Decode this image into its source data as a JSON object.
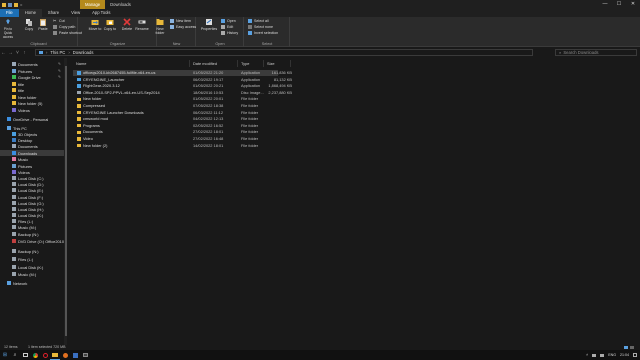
{
  "window": {
    "ribbon_context_tab": "Manage",
    "context_title": "Downloads",
    "minimize_glyph": "—",
    "maximize_glyph": "☐",
    "close_glyph": "✕",
    "title_glyph": "="
  },
  "ribbon_tabs": [
    "File",
    "Home",
    "Share",
    "View",
    "App Tools"
  ],
  "ribbon": {
    "clipboard": {
      "label": "Clipboard",
      "pin": "Pin to Quick access",
      "copy": "Copy",
      "paste": "Paste",
      "cut": "Cut",
      "copy_path": "Copy path",
      "paste_shortcut": "Paste shortcut"
    },
    "organize": {
      "label": "Organize",
      "move_to": "Move to",
      "copy_to": "Copy to",
      "delete": "Delete",
      "rename": "Rename"
    },
    "new": {
      "label": "New",
      "new_folder": "New folder",
      "new_item": "New item",
      "easy_access": "Easy access"
    },
    "open": {
      "label": "Open",
      "properties": "Properties",
      "open": "Open",
      "edit": "Edit",
      "history": "History"
    },
    "select": {
      "label": "Select",
      "select_all": "Select all",
      "select_none": "Select none",
      "invert_selection": "Invert selection"
    }
  },
  "address": {
    "back": "←",
    "forward": "→",
    "recent": "˅",
    "up": "↑",
    "crumbs": [
      "This PC",
      "Downloads"
    ],
    "search_placeholder": "Search Downloads"
  },
  "nav": {
    "items": [
      {
        "label": "Documents",
        "icon": "documents-icon",
        "pinned": true
      },
      {
        "label": "Pictures",
        "icon": "pictures-icon",
        "pinned": true
      },
      {
        "label": "Google Drive",
        "icon": "google-drive-icon",
        "pinned": true
      },
      {
        "label": "title",
        "icon": "folder-icon",
        "pinned": false
      },
      {
        "label": "title",
        "icon": "folder-icon",
        "pinned": false
      },
      {
        "label": "New folder",
        "icon": "folder-icon",
        "pinned": false
      },
      {
        "label": "New folder (5)",
        "icon": "folder-icon",
        "pinned": false
      },
      {
        "label": "Videos",
        "icon": "videos-icon",
        "pinned": false
      },
      {
        "label": "OneDrive - Personal",
        "icon": "onedrive-icon",
        "pinned": false
      },
      {
        "label": "This PC",
        "icon": "this-pc-icon",
        "pinned": false
      },
      {
        "label": "3D Objects",
        "icon": "3d-objects-icon",
        "pinned": false
      },
      {
        "label": "Desktop",
        "icon": "desktop-icon",
        "pinned": false
      },
      {
        "label": "Documents",
        "icon": "documents-icon",
        "pinned": false
      },
      {
        "label": "Downloads",
        "icon": "downloads-icon",
        "pinned": false
      },
      {
        "label": "Music",
        "icon": "music-icon",
        "pinned": false
      },
      {
        "label": "Pictures",
        "icon": "pictures-icon",
        "pinned": false
      },
      {
        "label": "Videos",
        "icon": "videos-icon",
        "pinned": false
      },
      {
        "label": "Local Disk (C:)",
        "icon": "drive-icon",
        "pinned": false
      },
      {
        "label": "Local Disk (D:)",
        "icon": "drive-icon",
        "pinned": false
      },
      {
        "label": "Local Disk (E:)",
        "icon": "drive-icon",
        "pinned": false
      },
      {
        "label": "Local Disk (F:)",
        "icon": "drive-icon",
        "pinned": false
      },
      {
        "label": "Local Disk (G:)",
        "icon": "drive-icon",
        "pinned": false
      },
      {
        "label": "Local Disk (H:)",
        "icon": "drive-icon",
        "pinned": false
      },
      {
        "label": "Local Disk (K:)",
        "icon": "drive-icon",
        "pinned": false
      },
      {
        "label": "Files (L:)",
        "icon": "drive-icon",
        "pinned": false
      },
      {
        "label": "Music (M:)",
        "icon": "drive-icon",
        "pinned": false
      },
      {
        "label": "Backup (N:)",
        "icon": "drive-icon",
        "pinned": false
      },
      {
        "label": "DVD Drive (O:) Office2010",
        "icon": "dvd-icon",
        "pinned": false
      },
      {
        "label": "Backup (N:)",
        "icon": "drive-icon",
        "pinned": false
      },
      {
        "label": "Files (L:)",
        "icon": "drive-icon",
        "pinned": false
      },
      {
        "label": "Local Disk (K:)",
        "icon": "drive-icon",
        "pinned": false
      },
      {
        "label": "Music (M:)",
        "icon": "drive-icon",
        "pinned": false
      },
      {
        "label": "Network",
        "icon": "network-icon",
        "pinned": false
      }
    ],
    "selected_index": 13,
    "pin_glyph": "✎"
  },
  "columns": {
    "name": "Name",
    "date": "Date modified",
    "type": "Type",
    "size": "Size"
  },
  "files": [
    {
      "name": "officeqs2010-kb2687455-fullfile-x64-en-us",
      "date": "01/05/2022 21:20",
      "type": "Application",
      "size": "161,836 KB",
      "kind": "app"
    },
    {
      "name": "CRYENGINE_Launcher",
      "date": "06/03/2022 19:17",
      "type": "Application",
      "size": "81,132 KB",
      "kind": "app"
    },
    {
      "name": "FlightGear-2020.3.12",
      "date": "01/05/2022 20:21",
      "type": "Application",
      "size": "1,868,494 KB",
      "kind": "app"
    },
    {
      "name": "Office-2010-SP2-PPVL-x64-en-US-Sep2014",
      "date": "18/06/2016 10:53",
      "type": "Disc Image...",
      "size": "2,237,880 KB",
      "kind": "disc"
    },
    {
      "name": "New folder",
      "date": "01/05/2022 20:01",
      "type": "File folder",
      "size": "",
      "kind": "folder"
    },
    {
      "name": "Compressed",
      "date": "07/05/2022 18:38",
      "type": "File folder",
      "size": "",
      "kind": "folder"
    },
    {
      "name": "CRYENGINE Launcher Downloads",
      "date": "06/03/2022 11:12",
      "type": "File folder",
      "size": "",
      "kind": "folder"
    },
    {
      "name": "cmsworld mod",
      "date": "04/02/2022 12:13",
      "type": "File folder",
      "size": "",
      "kind": "folder"
    },
    {
      "name": "Programs",
      "date": "02/05/2022 16:52",
      "type": "File folder",
      "size": "",
      "kind": "folder"
    },
    {
      "name": "Documents",
      "date": "27/02/2022 18:01",
      "type": "File folder",
      "size": "",
      "kind": "folder"
    },
    {
      "name": "Video",
      "date": "27/02/2022 16:48",
      "type": "File folder",
      "size": "",
      "kind": "folder"
    },
    {
      "name": "New folder (2)",
      "date": "14/02/2022 18:01",
      "type": "File folder",
      "size": "",
      "kind": "folder"
    }
  ],
  "selected_file": 0,
  "status": {
    "items": "12 items",
    "selected": "1 item selected  720 MB"
  },
  "taskbar": {
    "start_glyph": "⊞",
    "search_glyph": "⌕",
    "time": "21:04",
    "lang": "ENG"
  },
  "colors": {
    "accent": "#1c6fb5",
    "manage": "#b58a1c",
    "folder": "#e8b83a",
    "app": "#4a9fe0"
  }
}
